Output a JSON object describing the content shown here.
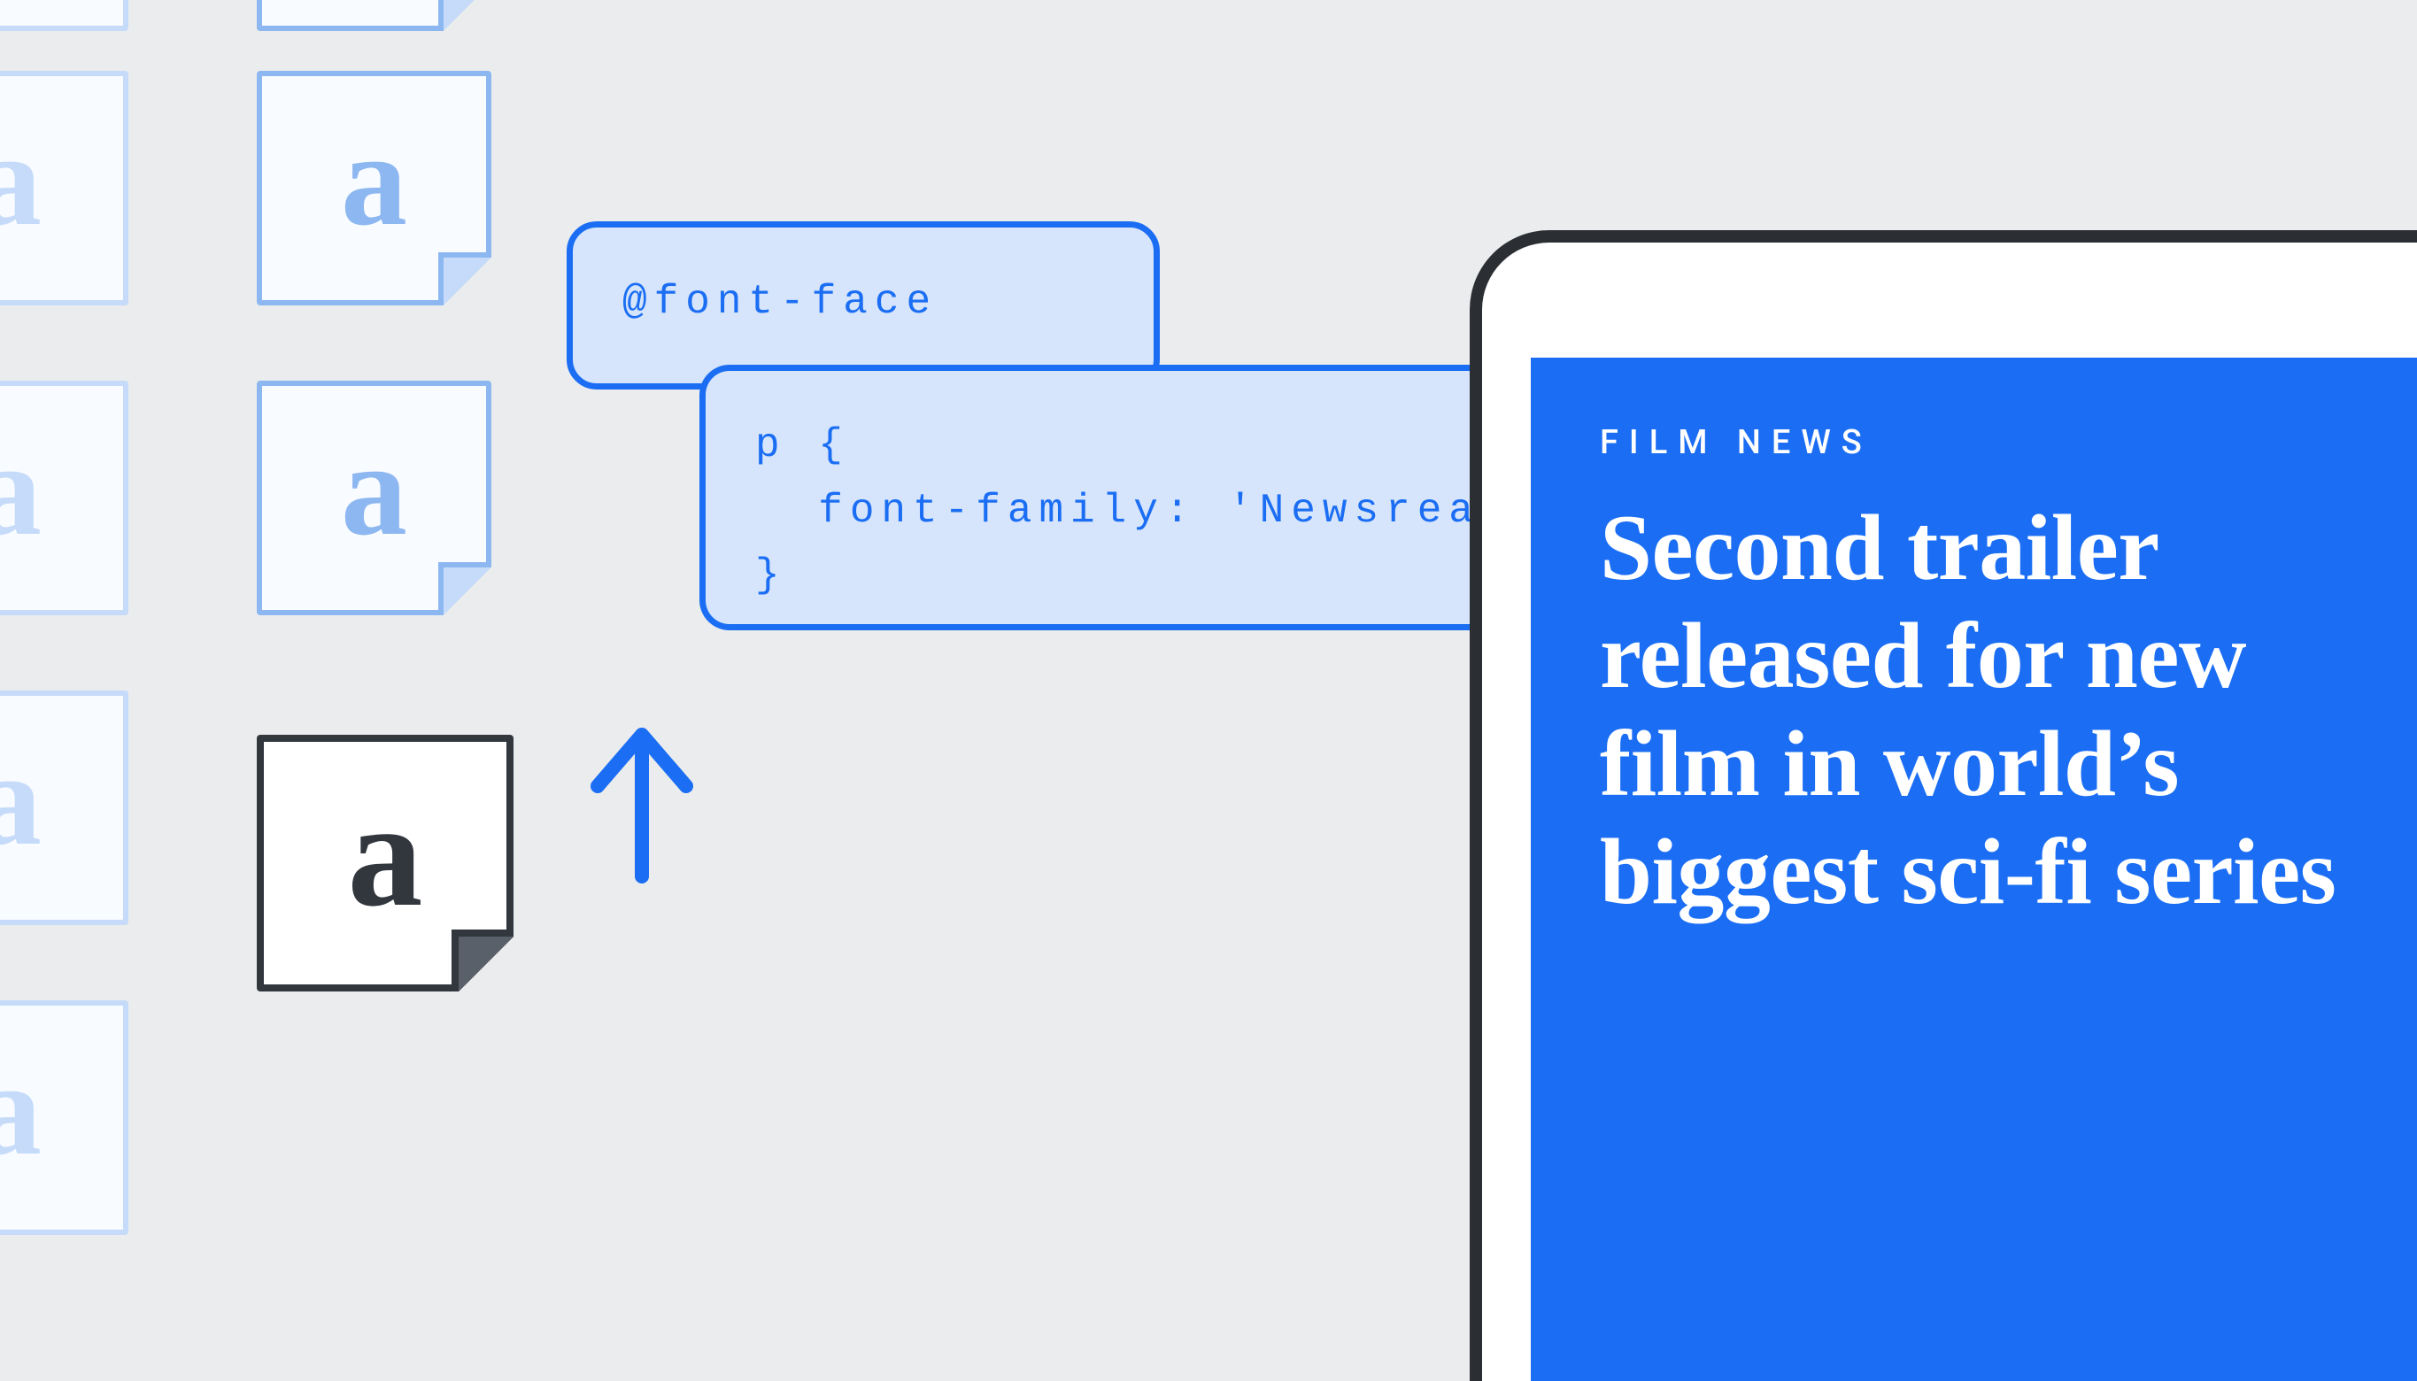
{
  "glyph": "a",
  "code": {
    "box1": "@font-face",
    "box2": "p {\n  font-family: 'Newsrea\n}"
  },
  "article": {
    "kicker": "FILM NEWS",
    "headline": "Second trailer released for new film in world’s biggest sci-fi series"
  },
  "colors": {
    "bg": "#ebeced",
    "blue": "#1b6ef3",
    "blue_lite": "#d6e5fb",
    "blue_line": "#8db7f0",
    "ink": "#31373d",
    "white": "#ffffff"
  }
}
